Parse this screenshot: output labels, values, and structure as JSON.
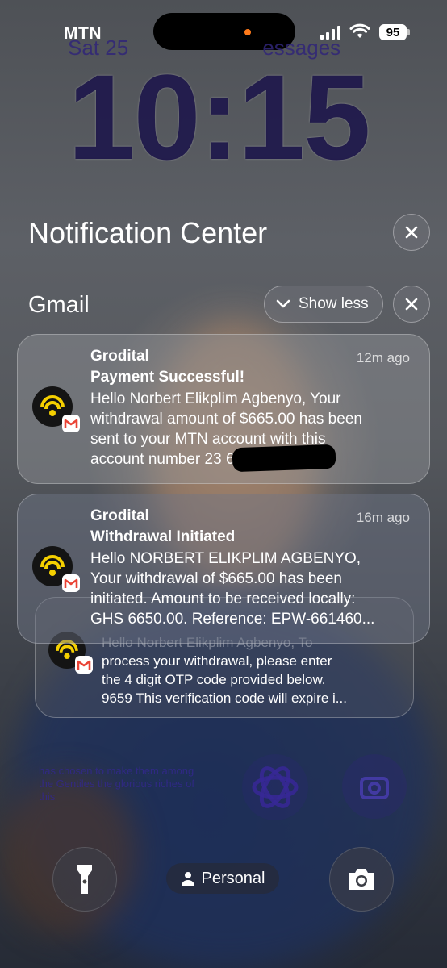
{
  "status_bar": {
    "carrier": "MTN",
    "battery": "95"
  },
  "lock_screen": {
    "date": "Sat 25                       essages",
    "time": "10:15"
  },
  "notification_center": {
    "title": "Notification Center",
    "group": {
      "app": "Gmail",
      "show_less_label": "Show less",
      "notifications": [
        {
          "sender": "Grodital",
          "time": "12m ago",
          "subject": "Payment Successful!",
          "body_lines": [
            "Hello Norbert Elikplim Agbenyo, Your",
            "withdrawal amount of $665.00 has been",
            "sent to your MTN account with this",
            "account number 23            659. Equiv..."
          ]
        },
        {
          "sender": "Grodital",
          "time": "16m ago",
          "subject": "Withdrawal Initiated",
          "body_lines": [
            "Hello NORBERT ELIKPLIM AGBENYO,",
            "Your withdrawal of $665.00 has been",
            "initiated. Amount to be received locally:",
            "GHS 6650.00. Reference: EPW-661460..."
          ]
        },
        {
          "body_lines": [
            "Hello Norbert Elikplim Agbenyo, To",
            "process your withdrawal, please enter",
            "the 4 digit OTP code provided below.",
            "9659 This verification code will expire i..."
          ]
        }
      ]
    }
  },
  "widget": {
    "text": "has chosen to make them among the Gentiles the glorious riches of this"
  },
  "bottom": {
    "focus_label": "Personal"
  },
  "colors": {
    "accent_orange": "#ff7a1a",
    "gmail_red": "#ea4335",
    "app_icon_yellow": "#f5d000"
  }
}
